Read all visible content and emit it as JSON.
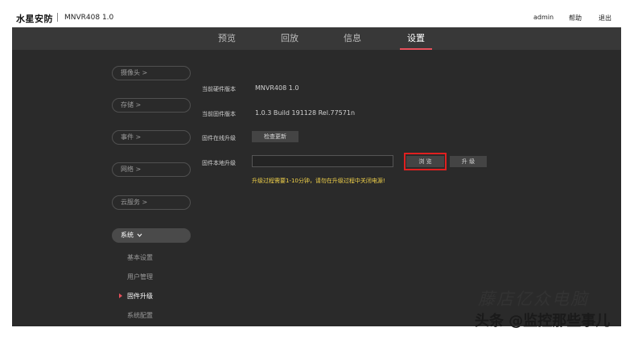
{
  "header": {
    "brand": "水星安防",
    "model": "MNVR408 1.0",
    "user": "admin",
    "help": "帮助",
    "logout": "退出"
  },
  "nav": {
    "tabs": [
      {
        "label": "预览"
      },
      {
        "label": "回放"
      },
      {
        "label": "信息"
      },
      {
        "label": "设置",
        "active": true
      }
    ]
  },
  "sidebar": {
    "items": [
      {
        "label": "摄像头 >"
      },
      {
        "label": "存储 >"
      },
      {
        "label": "事件 >"
      },
      {
        "label": "网络 >"
      },
      {
        "label": "云服务 >"
      },
      {
        "label": "系统",
        "active": true
      }
    ],
    "sub_items": [
      {
        "label": "基本设置"
      },
      {
        "label": "用户管理"
      },
      {
        "label": "固件升级",
        "active": true
      },
      {
        "label": "系统配置"
      }
    ]
  },
  "main": {
    "hw_version_label": "当前硬件版本",
    "hw_version_value": "MNVR408 1.0",
    "fw_version_label": "当前固件版本",
    "fw_version_value": "1.0.3 Build 191128 Rel.77571n",
    "online_upgrade_label": "固件在线升级",
    "check_update_button": "检查更新",
    "local_upgrade_label": "固件本地升级",
    "file_input_value": "",
    "browse_button": "浏 览",
    "upgrade_button": "升 级",
    "hint": "升级过程需要1-10分钟，请勿在升级过程中关闭电源!"
  },
  "watermark": {
    "line1": "藤店亿众电脑",
    "line2": "头条 @监控那些事儿"
  },
  "colors": {
    "accent": "#e8505b",
    "highlight_border": "#e02020",
    "hint_text": "#f2d24a",
    "panel_bg": "#2a2a2a",
    "nav_bg": "#383838"
  }
}
